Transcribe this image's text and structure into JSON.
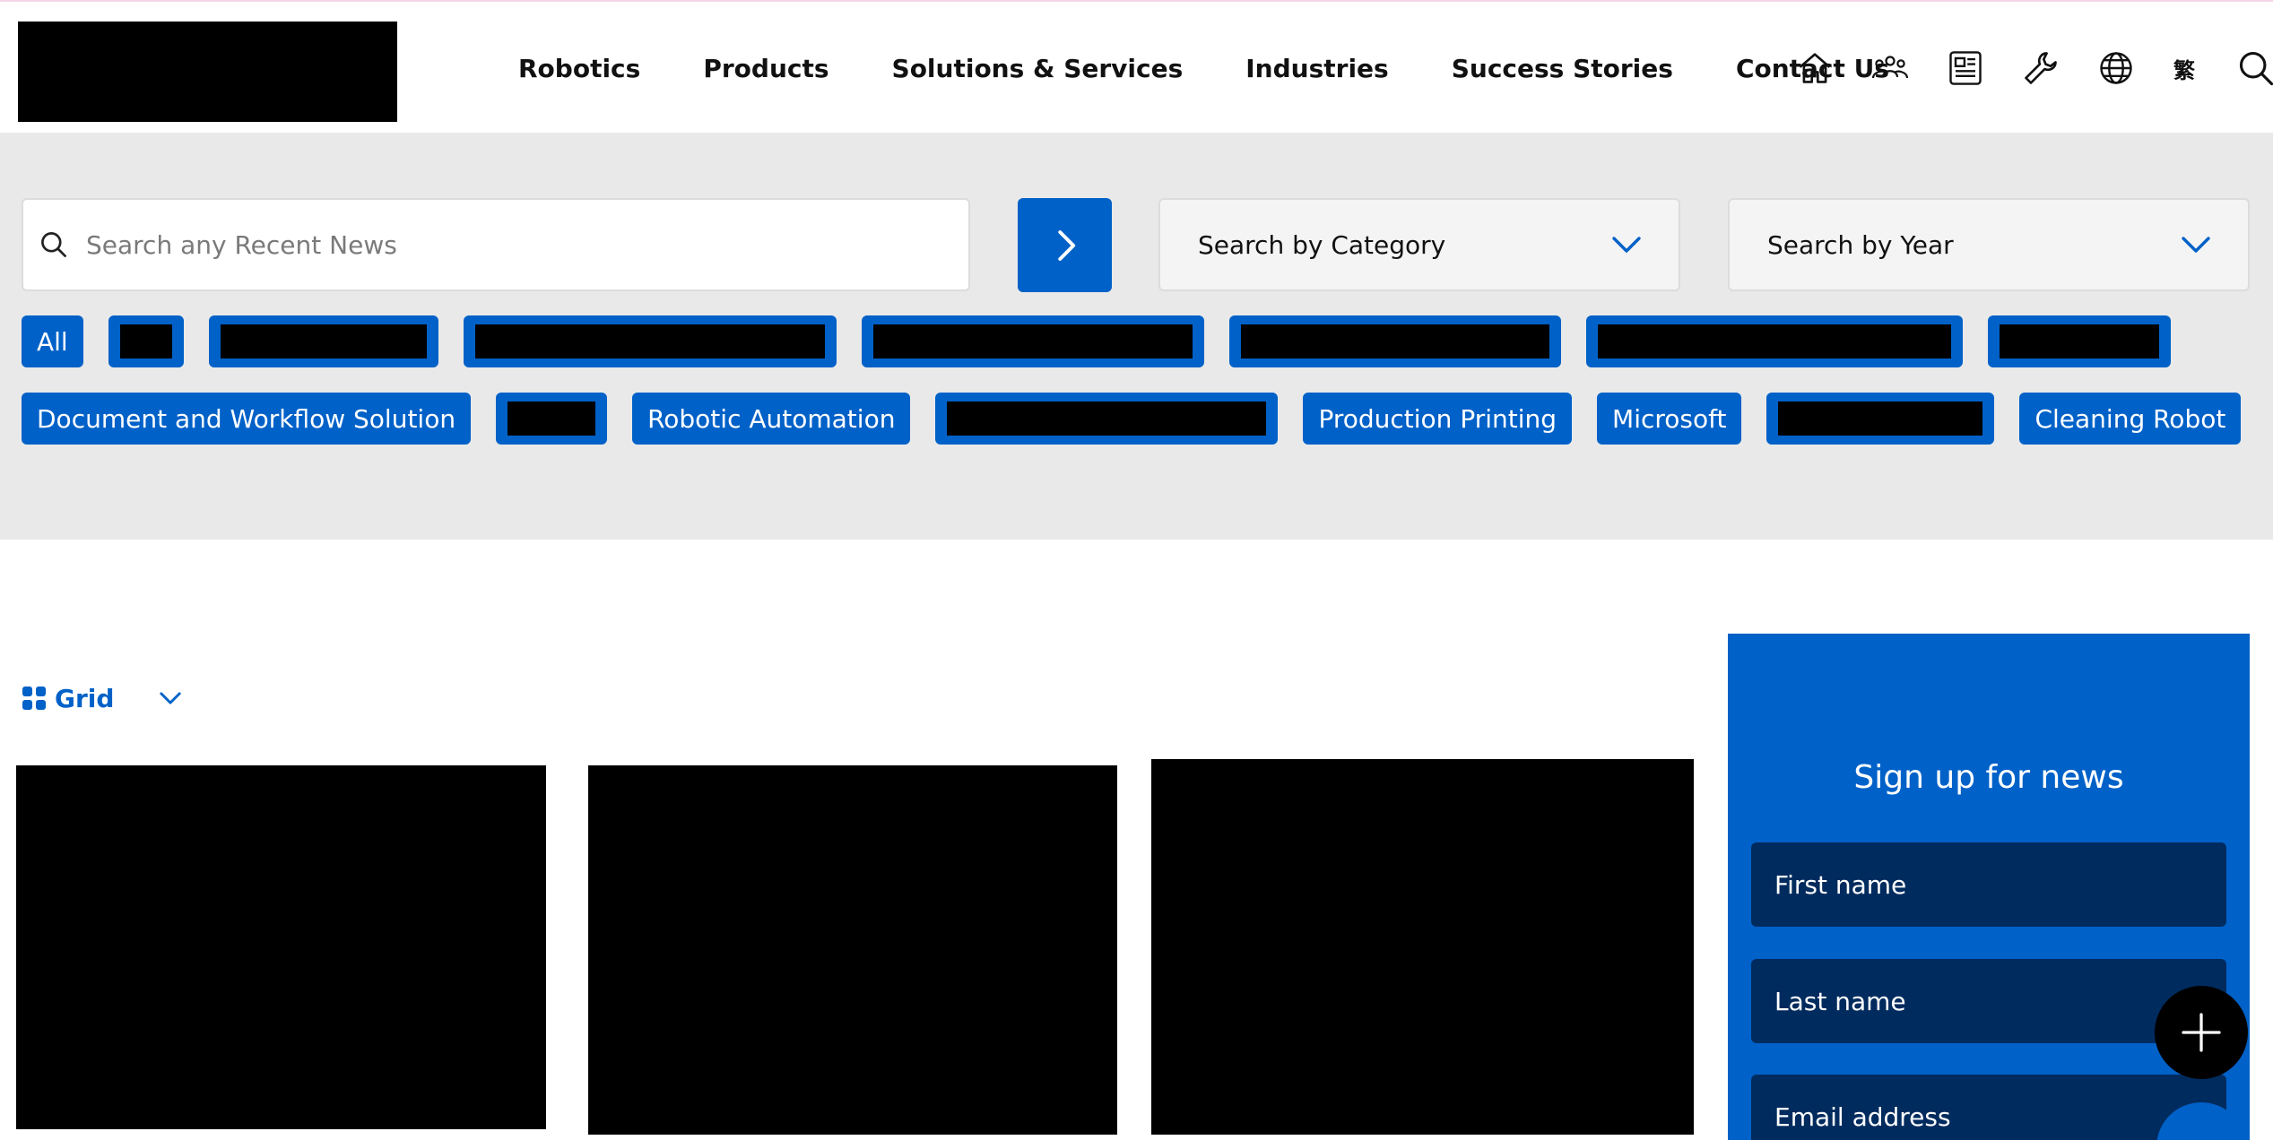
{
  "header": {
    "nav": [
      "Robotics",
      "Products",
      "Solutions & Services",
      "Industries",
      "Success Stories",
      "Contact Us"
    ],
    "icons": [
      "home-icon",
      "people-icon",
      "news-icon",
      "wrench-icon",
      "globe-icon",
      "language-icon",
      "search-icon"
    ],
    "lang_label": "繁"
  },
  "filters": {
    "search_placeholder": "Search any Recent News",
    "category_label": "Search by Category",
    "year_label": "Search by Year",
    "tags_row1": [
      {
        "label": "All"
      },
      {
        "label": ""
      },
      {
        "label": ""
      },
      {
        "label": ""
      },
      {
        "label": ""
      },
      {
        "label": ""
      },
      {
        "label": ""
      },
      {
        "label": ""
      }
    ],
    "tags_row2": [
      {
        "label": "Document and Workflow Solution"
      },
      {
        "label": ""
      },
      {
        "label": "Robotic Automation"
      },
      {
        "label": ""
      },
      {
        "label": "Production Printing"
      },
      {
        "label": "Microsoft"
      },
      {
        "label": ""
      },
      {
        "label": "Cleaning Robot"
      }
    ]
  },
  "view": {
    "mode_label": "Grid"
  },
  "signup": {
    "title": "Sign up for news",
    "first_name": "First name",
    "last_name": "Last name",
    "email": "Email address"
  },
  "colors": {
    "brand_blue": "#0061c8",
    "dark_navy": "#002b5e",
    "filter_bg": "#e9e9e9"
  }
}
